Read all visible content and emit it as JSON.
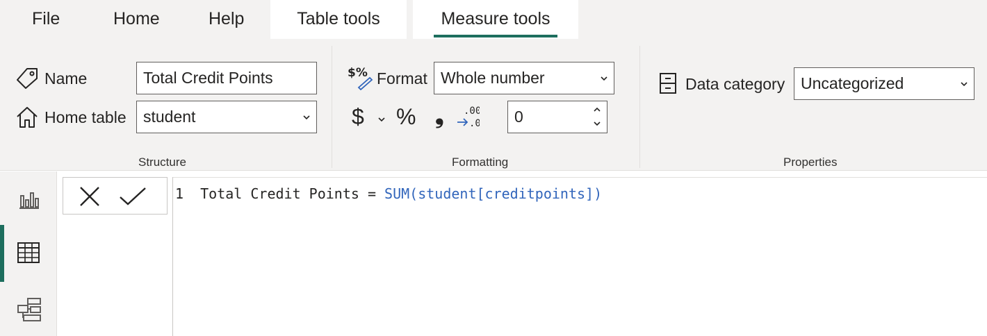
{
  "menu": {
    "file": "File",
    "home": "Home",
    "help": "Help",
    "table_tools": "Table tools",
    "measure_tools": "Measure tools"
  },
  "structure": {
    "name_label": "Name",
    "name_value": "Total Credit Points",
    "home_table_label": "Home table",
    "home_table_value": "student",
    "group_label": "Structure"
  },
  "formatting": {
    "format_label": "Format",
    "format_value": "Whole number",
    "currency_symbol": "$",
    "percent_symbol": "%",
    "comma_symbol": "❟",
    "decimal_places": "0",
    "group_label": "Formatting"
  },
  "properties": {
    "data_category_label": "Data category",
    "data_category_value": "Uncategorized",
    "group_label": "Properties"
  },
  "formula": {
    "line_number": "1",
    "prefix": "Total Credit Points = ",
    "function": "SUM",
    "argument": "(student[creditpoints])"
  },
  "colors": {
    "accent": "#1d6e5e",
    "function_blue": "#3165bb",
    "ribbon_bg": "#f3f2f1"
  },
  "icons": [
    "tag-icon",
    "home-icon",
    "currency-format-icon",
    "dollar-icon",
    "percent-icon",
    "comma-icon",
    "decimal-icon",
    "data-category-icon",
    "report-view-icon",
    "table-view-icon",
    "model-view-icon",
    "cancel-icon",
    "commit-icon"
  ]
}
